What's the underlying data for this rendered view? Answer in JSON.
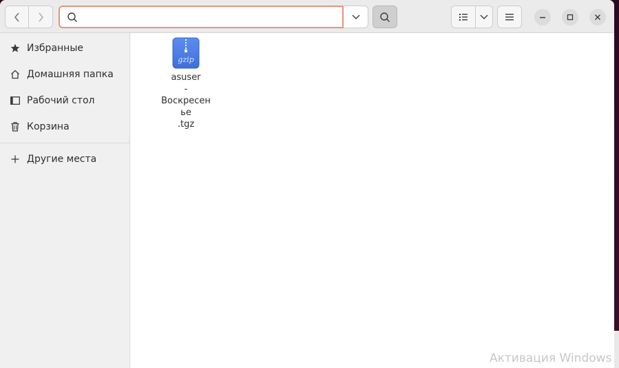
{
  "headerbar": {
    "back_icon": "chevron-left-icon",
    "forward_icon": "chevron-right-icon",
    "search_value": "",
    "search_placeholder": "",
    "search_icon": "search-icon",
    "dropdown_icon": "chevron-down-icon",
    "search_toggle_icon": "search-icon",
    "view_icon": "list-view-icon",
    "view_dropdown_icon": "chevron-down-icon",
    "menu_icon": "hamburger-menu-icon",
    "minimize_icon": "minimize-icon",
    "maximize_icon": "maximize-icon",
    "close_icon": "close-icon"
  },
  "sidebar": {
    "items": [
      {
        "label": "Избранные",
        "icon": "star-icon"
      },
      {
        "label": "Домашняя папка",
        "icon": "home-icon"
      },
      {
        "label": "Рабочий стол",
        "icon": "desktop-icon"
      },
      {
        "label": "Корзина",
        "icon": "trash-icon"
      }
    ],
    "other_places": {
      "label": "Другие места",
      "icon": "plus-icon"
    }
  },
  "files": [
    {
      "name": "asuser\n-\nВоскресен\nье\n.tgz",
      "icon_text": "gzip",
      "icon": "archive-icon"
    }
  ],
  "watermark": "Активация Windows",
  "colors": {
    "accent": "#e8927c",
    "archive_icon": "#4a7fe0",
    "background": "#2c0a1e"
  }
}
